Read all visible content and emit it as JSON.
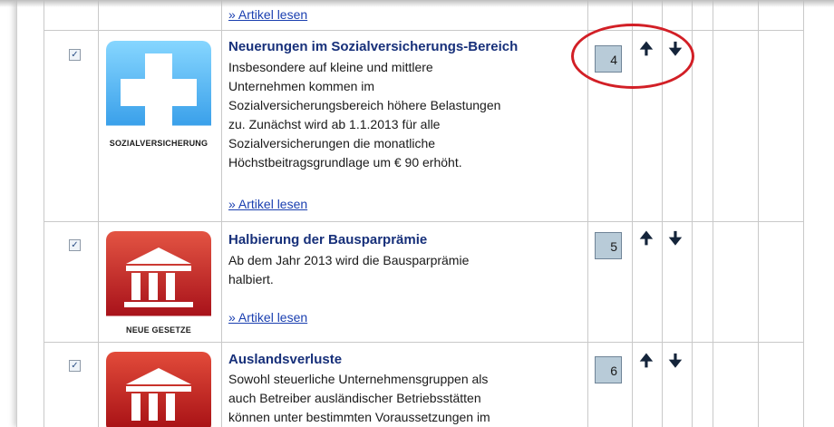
{
  "previous_link": "» Artikel lesen",
  "articles": [
    {
      "title": "Neuerungen im Sozialversicherungs-Bereich",
      "lines": [
        "Insbesondere auf kleine und mittlere",
        "Unternehmen kommen im",
        "Sozialversicherungsbereich höhere Belastungen",
        "zu. Zunächst wird ab 1.1.2013 für alle",
        "Sozialversicherungen die monatliche",
        "Höchstbeitragsgrundlage um € 90 erhöht."
      ],
      "link": "» Artikel lesen",
      "order": "4",
      "image_label": "SOZIALVERSICHERUNG",
      "checked": true
    },
    {
      "title": "Halbierung der Bausparprämie",
      "lines": [
        "Ab dem Jahr 2013 wird die Bausparprämie",
        "halbiert."
      ],
      "link": "» Artikel lesen",
      "order": "5",
      "image_label": "NEUE GESETZE",
      "checked": true
    },
    {
      "title": "Auslandsverluste",
      "lines": [
        "Sowohl steuerliche Unternehmensgruppen als",
        "auch Betreiber ausländischer Betriebsstätten",
        "können unter bestimmten Voraussetzungen im"
      ],
      "link": "",
      "order": "6",
      "image_label": "",
      "checked": true
    }
  ],
  "icons": {
    "checkbox": "✓",
    "up": "🠉",
    "down": "🠋"
  },
  "colors": {
    "title": "#17307a",
    "link": "#1a3fb0",
    "highlight_ring": "#d21f26"
  }
}
